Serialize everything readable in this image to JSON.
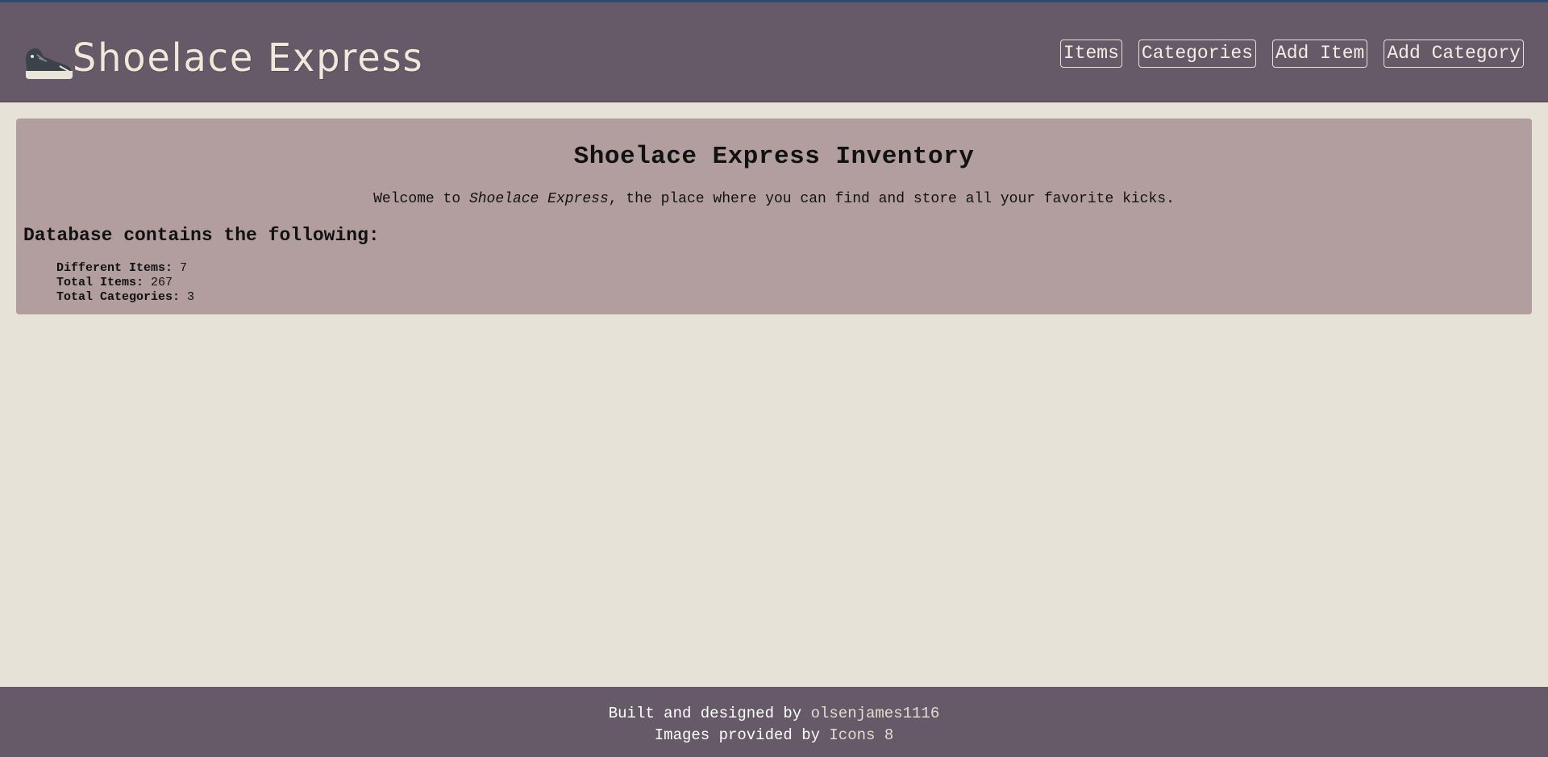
{
  "header": {
    "brand_name": "Shoelace Express",
    "logo_icon": "sneaker-icon",
    "nav": [
      {
        "label": "Items"
      },
      {
        "label": "Categories"
      },
      {
        "label": "Add Item"
      },
      {
        "label": "Add Category"
      }
    ]
  },
  "main": {
    "title": "Shoelace Express Inventory",
    "welcome_prefix": "Welcome to ",
    "welcome_emphasis": "Shoelace Express",
    "welcome_suffix": ", the place where you can find and store all your favorite kicks.",
    "stats_heading": "Database contains the following:",
    "stats": [
      {
        "label": "Different Items:",
        "value": "7"
      },
      {
        "label": "Total Items:",
        "value": "267"
      },
      {
        "label": "Total Categories:",
        "value": "3"
      }
    ]
  },
  "footer": {
    "built_prefix": "Built and designed by ",
    "built_link": "olsenjames1116",
    "images_prefix": "Images provided by ",
    "images_link": "Icons 8"
  },
  "colors": {
    "header_bg": "#665a68",
    "page_bg": "#e6e2d7",
    "panel_bg": "#b29e9f",
    "accent_line": "#2c4a6e"
  }
}
